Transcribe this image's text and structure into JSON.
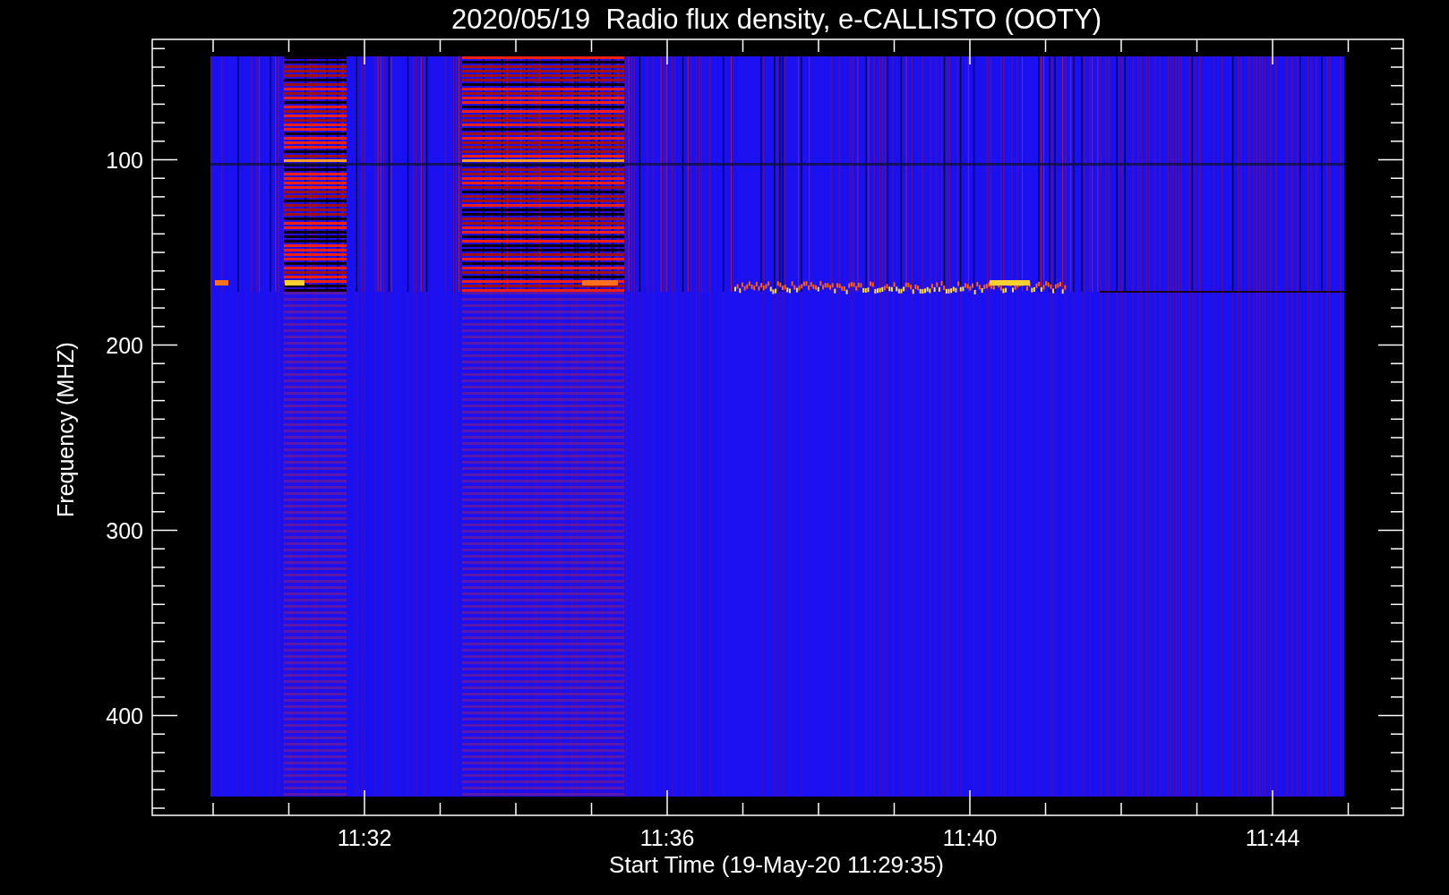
{
  "title": "2020/05/19  Radio flux density, e-CALLISTO (OOTY)",
  "y_axis": {
    "label": "Frequency (MHZ)",
    "ticks": [
      "100",
      "200",
      "300",
      "400"
    ]
  },
  "x_axis": {
    "label": "Start Time (19-May-20 11:29:35)",
    "ticks": [
      "11:32",
      "11:36",
      "11:40",
      "11:44"
    ]
  }
}
